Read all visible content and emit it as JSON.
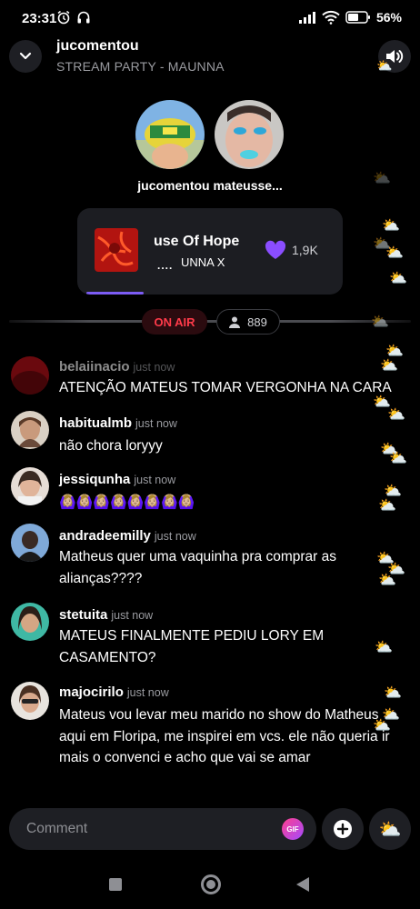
{
  "status_bar": {
    "time": "23:31",
    "battery": "56%"
  },
  "header": {
    "title": "jucomentou",
    "subtitle": "STREAM PARTY - MAUNNA"
  },
  "participants": {
    "names": "jucomentou mateusse..."
  },
  "now_playing": {
    "title": "use Of Hope",
    "artist": "UNNA X",
    "playing_indicator": "....",
    "likes": "1,9K",
    "progress": 0.23
  },
  "live": {
    "badge": "ON AIR",
    "viewers": "889"
  },
  "comments": [
    {
      "user": "belaiinacio",
      "time": "just now",
      "text": "ATENÇÃO MATEUS TOMAR VERGONHA NA CARA"
    },
    {
      "user": "habitualmb",
      "time": "just now",
      "text": "não chora loryyy"
    },
    {
      "user": "jessiqunha",
      "time": "just now",
      "text": "🙆🏼‍♀️🙆🏼‍♀️🙆🏼‍♀️🙆🏼‍♀️🙆🏼‍♀️🙆🏼‍♀️🙆🏼‍♀️🙆🏼‍♀️"
    },
    {
      "user": "andradeemilly",
      "time": "just now",
      "text": "Matheus quer uma vaquinha pra comprar as alianças????"
    },
    {
      "user": "stetuita",
      "time": "just now",
      "text": "MATEUS FINALMENTE PEDIU LORY EM CASAMENTO?"
    },
    {
      "user": "majocirilo",
      "time": "just now",
      "text": "Mateus vou levar meu marido no show do Matheus aqui em Floripa, me inspirei em vcs. ele não queria ir mais o convenci e acho que vai se amar"
    }
  ],
  "composer": {
    "placeholder": "Comment",
    "gif_label": "GIF",
    "reaction_icon": "⛅"
  },
  "colors": {
    "accent": "#7c5cf5",
    "on_air": "#ff3b4a"
  }
}
